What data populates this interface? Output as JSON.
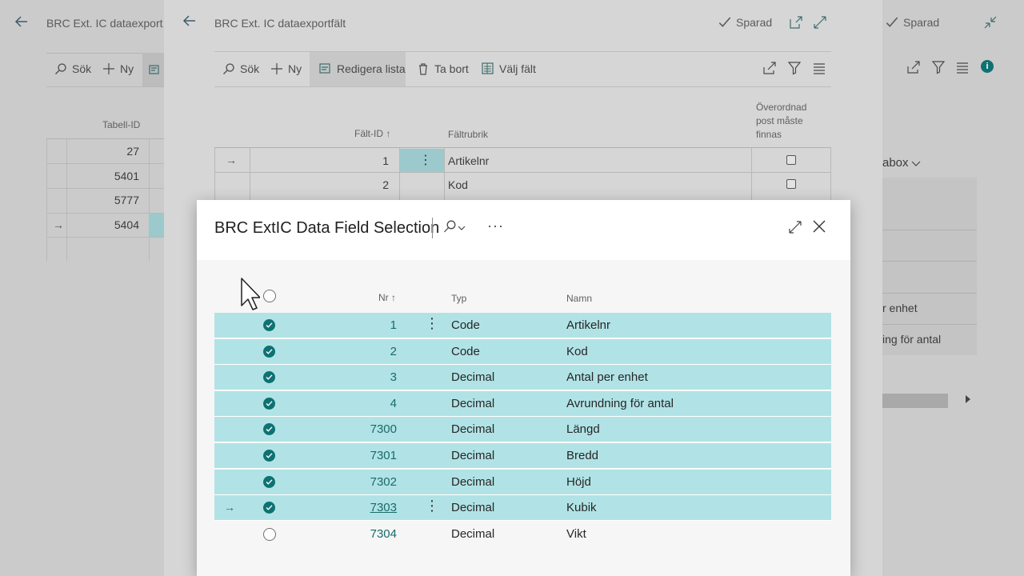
{
  "back_pane": {
    "title": "BRC Ext. IC dataexport",
    "toolbar": {
      "search": "Sök",
      "new": "Ny"
    },
    "column_header": "Tabell-ID",
    "rows": [
      "27",
      "5401",
      "5777",
      "5404"
    ]
  },
  "mid_pane": {
    "title": "BRC Ext. IC dataexportfält",
    "saved_label": "Sparad",
    "toolbar": {
      "search": "Sök",
      "new": "Ny",
      "edit_list": "Redigera lista",
      "delete": "Ta bort",
      "choose_fields": "Välj fält"
    },
    "columns": {
      "field_id": "Fält-ID",
      "caption": "Fältrubrik",
      "parent_required": "Överordnad post måste finnas"
    },
    "parent_required_lines": [
      "Överordnad",
      "post måste",
      "finnas"
    ],
    "rows": [
      {
        "id": "1",
        "caption": "Artikelnr"
      },
      {
        "id": "2",
        "caption": "Kod"
      }
    ]
  },
  "right_pane": {
    "saved_label": "Sparad",
    "partial_labels": [
      "abox",
      "r enhet",
      "ing för antal"
    ]
  },
  "modal": {
    "title": "BRC ExtIC Data Field Selection",
    "columns": {
      "nr": "Nr",
      "type": "Typ",
      "name": "Namn"
    },
    "rows": [
      {
        "nr": "1",
        "type": "Code",
        "name": "Artikelnr",
        "selected": true
      },
      {
        "nr": "2",
        "type": "Code",
        "name": "Kod",
        "selected": true
      },
      {
        "nr": "3",
        "type": "Decimal",
        "name": "Antal per enhet",
        "selected": true
      },
      {
        "nr": "4",
        "type": "Decimal",
        "name": "Avrundning för antal",
        "selected": true
      },
      {
        "nr": "7300",
        "type": "Decimal",
        "name": "Längd",
        "selected": true
      },
      {
        "nr": "7301",
        "type": "Decimal",
        "name": "Bredd",
        "selected": true
      },
      {
        "nr": "7302",
        "type": "Decimal",
        "name": "Höjd",
        "selected": true
      },
      {
        "nr": "7303",
        "type": "Decimal",
        "name": "Kubik",
        "selected": true
      },
      {
        "nr": "7304",
        "type": "Decimal",
        "name": "Vikt",
        "selected": false
      }
    ]
  },
  "colors": {
    "accent": "#0e7172",
    "selected_row": "#b1e3e6"
  }
}
